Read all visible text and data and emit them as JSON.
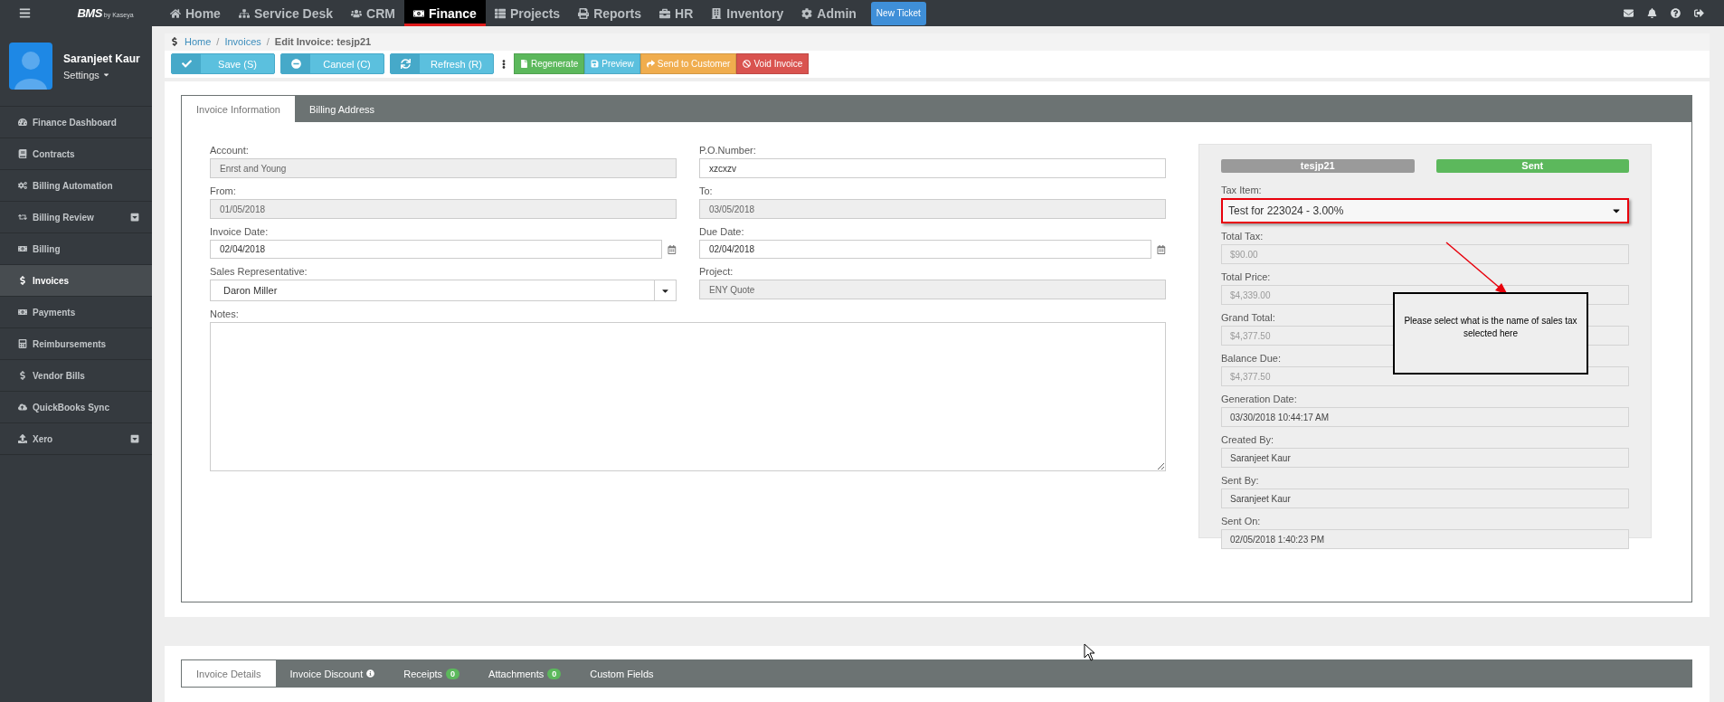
{
  "topbar": {
    "logo": "BMS",
    "logo_sub": "by Kaseya",
    "nav": [
      {
        "label": "Home",
        "selected": false
      },
      {
        "label": "Service Desk",
        "selected": false
      },
      {
        "label": "CRM",
        "selected": false
      },
      {
        "label": "Finance",
        "selected": true
      },
      {
        "label": "Projects",
        "selected": false
      },
      {
        "label": "Reports",
        "selected": false
      },
      {
        "label": "HR",
        "selected": false
      },
      {
        "label": "Inventory",
        "selected": false
      },
      {
        "label": "Admin",
        "selected": false
      }
    ],
    "new_ticket": "New Ticket"
  },
  "user": {
    "name": "Saranjeet Kaur",
    "settings": "Settings"
  },
  "sidebar": {
    "items": [
      {
        "label": "Finance Dashboard",
        "selected": false,
        "expandable": false
      },
      {
        "label": "Contracts",
        "selected": false,
        "expandable": false
      },
      {
        "label": "Billing Automation",
        "selected": false,
        "expandable": false
      },
      {
        "label": "Billing Review",
        "selected": false,
        "expandable": true
      },
      {
        "label": "Billing",
        "selected": false,
        "expandable": false
      },
      {
        "label": "Invoices",
        "selected": true,
        "expandable": false
      },
      {
        "label": "Payments",
        "selected": false,
        "expandable": false
      },
      {
        "label": "Reimbursements",
        "selected": false,
        "expandable": false
      },
      {
        "label": "Vendor Bills",
        "selected": false,
        "expandable": false
      },
      {
        "label": "QuickBooks Sync",
        "selected": false,
        "expandable": false
      },
      {
        "label": "Xero",
        "selected": false,
        "expandable": true
      }
    ]
  },
  "breadcrumb": {
    "links": [
      "Home",
      "Invoices"
    ],
    "separators": [
      "/",
      "/"
    ],
    "current": "Edit Invoice: tesjp21"
  },
  "toolbar": {
    "buttons": [
      {
        "label": "Save (S)",
        "kind": "save"
      },
      {
        "label": "Cancel (C)",
        "kind": "cancel"
      },
      {
        "label": "Refresh (R)",
        "kind": "refresh"
      }
    ],
    "actions": [
      {
        "label": "Regenerate",
        "kind": "regenerate",
        "color": "#5cb85c"
      },
      {
        "label": "Preview",
        "kind": "preview",
        "color": "#5bc0de"
      },
      {
        "label": "Send to Customer",
        "kind": "send",
        "color": "#f0ad4e"
      },
      {
        "label": "Void Invoice",
        "kind": "void",
        "color": "#d9534f"
      }
    ]
  },
  "tabs": [
    {
      "label": "Invoice Information",
      "selected": true
    },
    {
      "label": "Billing Address",
      "selected": false
    }
  ],
  "form": {
    "fields": [
      {
        "label": "Account:",
        "value": "Enrst and Young",
        "kind": "text",
        "disabled": true
      },
      {
        "label": "P.O.Number:",
        "value": "xzcxzv",
        "kind": "text",
        "disabled": false
      },
      {
        "label": "From:",
        "value": "01/05/2018",
        "kind": "text",
        "disabled": true
      },
      {
        "label": "To:",
        "value": "03/05/2018",
        "kind": "text",
        "disabled": true
      },
      {
        "label": "Invoice Date:",
        "value": "02/04/2018",
        "kind": "date",
        "disabled": false
      },
      {
        "label": "Due Date:",
        "value": "02/04/2018",
        "kind": "date",
        "disabled": false
      },
      {
        "label": "Sales Representative:",
        "value": "Daron Miller",
        "kind": "select",
        "disabled": false
      },
      {
        "label": "Project:",
        "value": "ENY Quote",
        "kind": "text",
        "disabled": true
      }
    ],
    "notes": {
      "label": "Notes:"
    }
  },
  "summary": {
    "badges": [
      {
        "label": "tesjp21",
        "color": "#9a9a9a"
      },
      {
        "label": "Sent",
        "color": "#5cb85c"
      }
    ],
    "tax_item": {
      "label": "Tax Item:",
      "value": "Test for 223024 - 3.00%",
      "highlighted": true
    },
    "fields": [
      {
        "label": "Total Tax:",
        "value": "$90.00",
        "disabled": true
      },
      {
        "label": "Total Price:",
        "value": "$4,339.00",
        "disabled": true
      },
      {
        "label": "Grand Total:",
        "value": "$4,377.50",
        "disabled": true
      },
      {
        "label": "Balance Due:",
        "value": "$4,377.50",
        "disabled": true
      },
      {
        "label": "Generation Date:",
        "value": "03/30/2018 10:44:17 AM",
        "disabled": false
      },
      {
        "label": "Created By:",
        "value": "Saranjeet Kaur",
        "disabled": false
      },
      {
        "label": "Sent By:",
        "value": "Saranjeet Kaur",
        "disabled": false
      },
      {
        "label": "Sent On:",
        "value": "02/05/2018 1:40:23 PM",
        "disabled": false
      }
    ]
  },
  "annotation": {
    "text": "Please select what is the name of sales tax selected here"
  },
  "bottom_tabs": [
    {
      "label": "Invoice Details",
      "selected": true,
      "kind": "plain"
    },
    {
      "label": "Invoice Discount",
      "selected": false,
      "kind": "info"
    },
    {
      "label": "Receipts",
      "selected": false,
      "kind": "count",
      "count": "0"
    },
    {
      "label": "Attachments",
      "selected": false,
      "kind": "count",
      "count": "0"
    },
    {
      "label": "Custom Fields",
      "selected": false,
      "kind": "plain"
    }
  ]
}
